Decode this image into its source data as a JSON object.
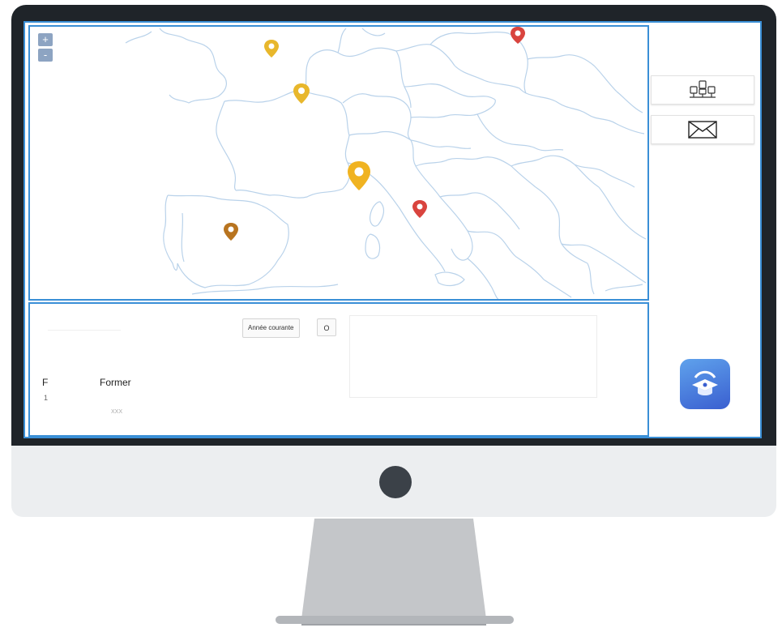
{
  "map": {
    "zoom_in": "+",
    "zoom_out": "-",
    "markers": [
      {
        "name": "marker-london",
        "color": "#e8b72c"
      },
      {
        "name": "marker-paris",
        "color": "#e8b72c"
      },
      {
        "name": "marker-nice",
        "color": "#f0b321"
      },
      {
        "name": "marker-madrid",
        "color": "#b8741f"
      },
      {
        "name": "marker-rome",
        "color": "#d9443e"
      },
      {
        "name": "marker-warsaw",
        "color": "#d9443e"
      }
    ],
    "border_color": "#b9d2ea"
  },
  "stats": {
    "period_button": "Année courante",
    "period_toggle": "O",
    "letter": "F",
    "digit": "1",
    "label": "Former",
    "value": "XXX"
  },
  "sidebar": {
    "buttons": [
      {
        "icon": "people-group-icon"
      },
      {
        "icon": "envelope-icon"
      }
    ],
    "app_icon": "graduation-cap-icon"
  },
  "colors": {
    "frame": "#1f2429",
    "accent": "#3a8fd6",
    "app_gradient_start": "#5fa2ec",
    "app_gradient_end": "#3a5fd0"
  }
}
